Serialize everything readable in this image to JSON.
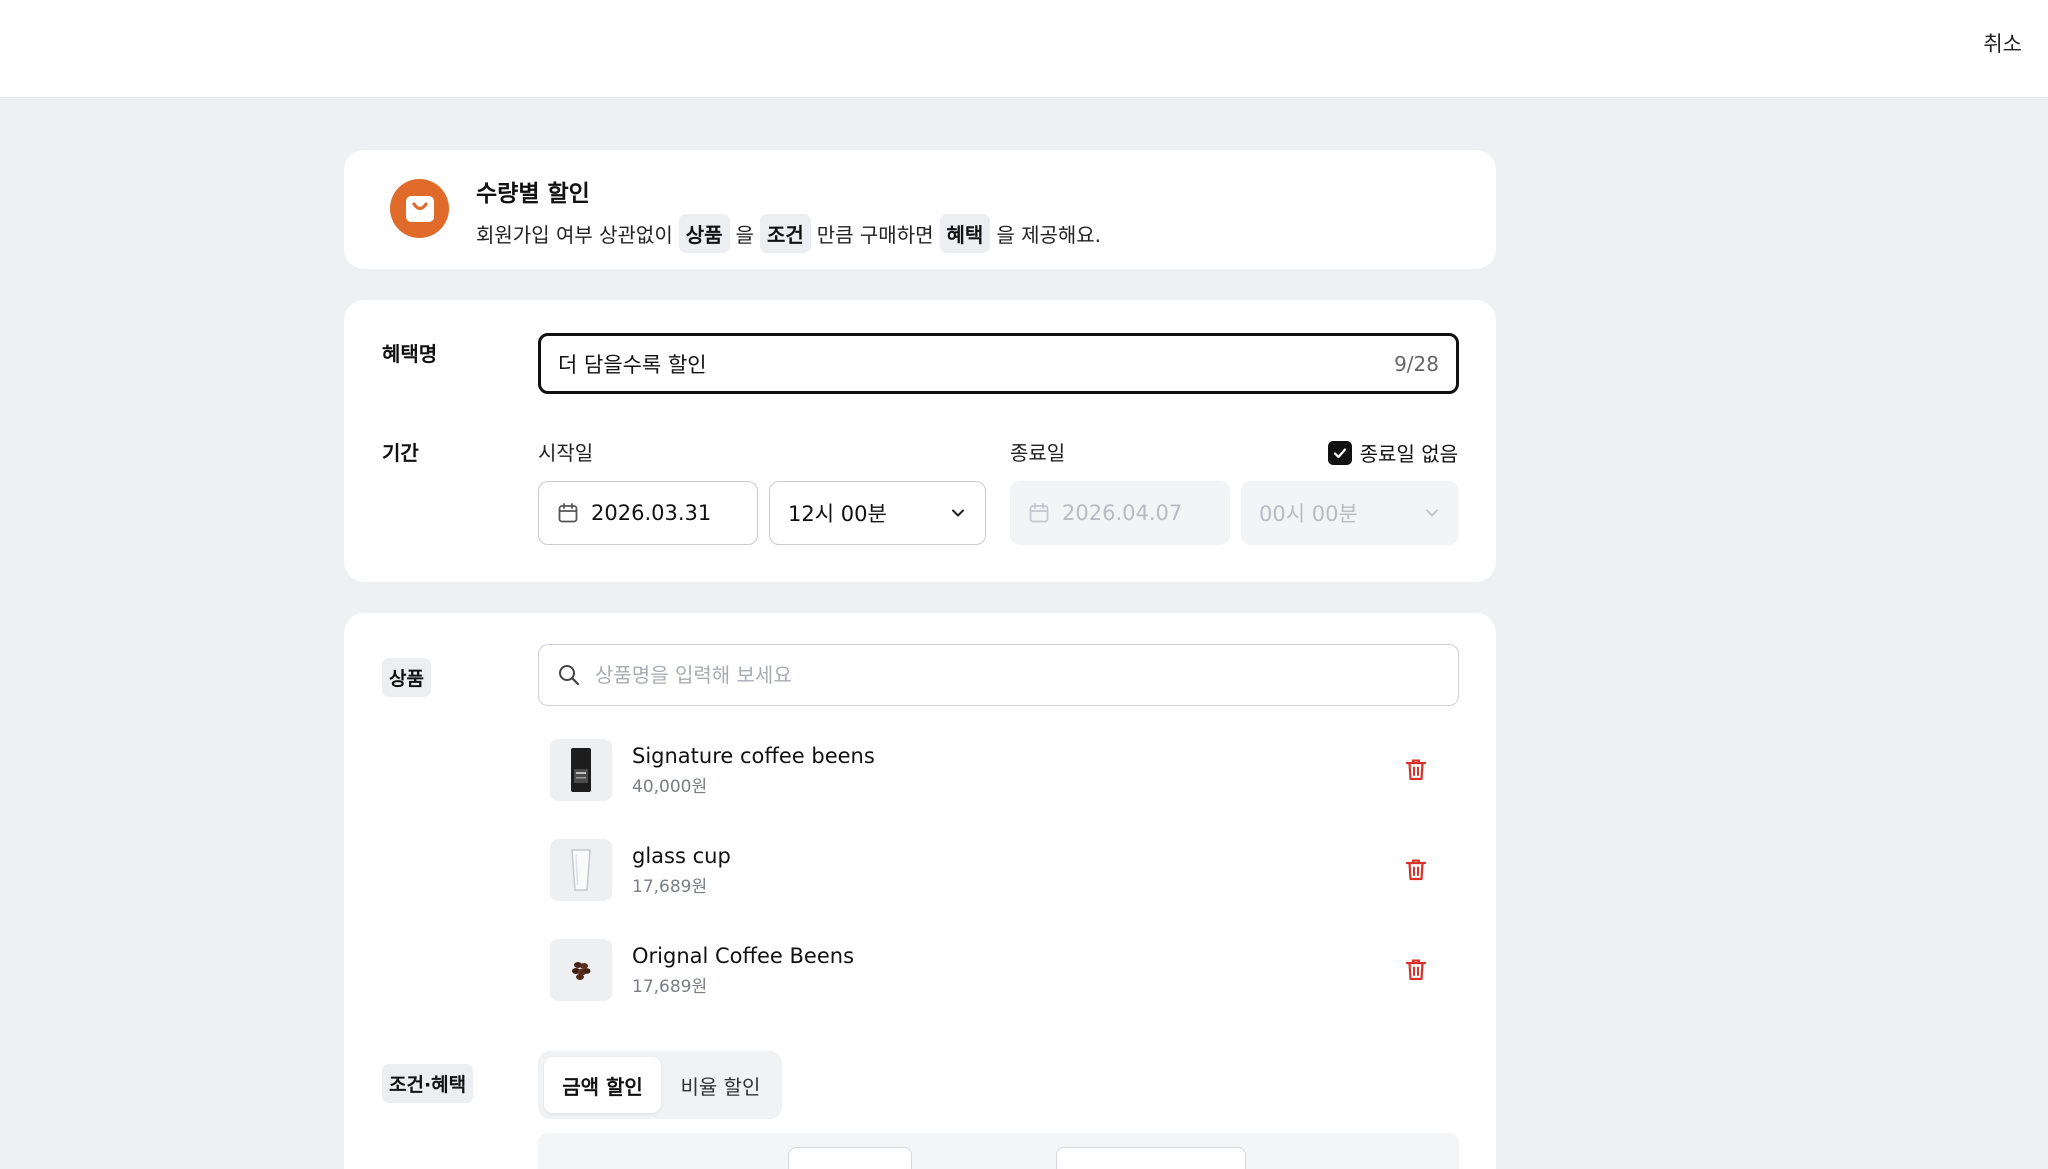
{
  "header": {
    "cancel_label": "취소"
  },
  "intro": {
    "title": "수량별 할인",
    "desc_part1": "회원가입 여부 상관없이",
    "chip_product": "상품",
    "particle1": "을",
    "chip_condition": "조건",
    "desc_part2": "만큼 구매하면",
    "chip_benefit": "혜택",
    "desc_part3": "을 제공해요.",
    "icon": "shopping-bag-icon",
    "accent": "#e06a2a"
  },
  "form": {
    "name_label": "혜택명",
    "name_value": "더 담을수록 할인",
    "name_count": "9/28",
    "period_label": "기간",
    "start_label": "시작일",
    "start_date": "2026.03.31",
    "start_time": "12시 00분",
    "end_label": "종료일",
    "end_date": "2026.04.07",
    "end_time": "00시 00분",
    "no_end_label": "종료일 없음",
    "no_end_checked": true
  },
  "products": {
    "label": "상품",
    "search_placeholder": "상품명을 입력해 보세요",
    "items": [
      {
        "name": "Signature coffee beens",
        "price": "40,000원"
      },
      {
        "name": "glass cup",
        "price": "17,689원"
      },
      {
        "name": "Orignal Coffee Beens",
        "price": "17,689원"
      }
    ],
    "delete_color": "#d9322b"
  },
  "conditions": {
    "label": "조건·혜택",
    "tabs": [
      {
        "label": "금액 할인",
        "selected": true
      },
      {
        "label": "비율 할인",
        "selected": false
      }
    ]
  }
}
